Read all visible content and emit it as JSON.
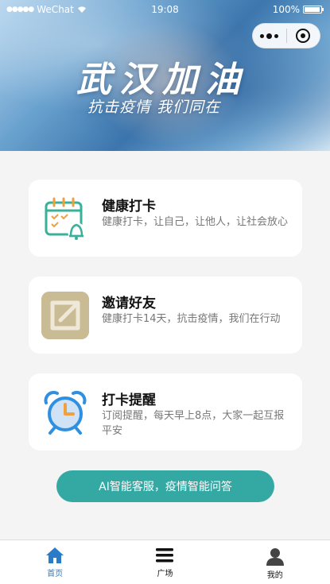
{
  "status_bar": {
    "signal": "●●●●●",
    "carrier": "WeChat",
    "time": "19:08",
    "battery": "100%"
  },
  "hero": {
    "title": "武汉加油",
    "subtitle": "抗击疫情 我们同在"
  },
  "cards": [
    {
      "title": "健康打卡",
      "desc": "健康打卡，让自己，让他人，让社会放心",
      "icon": "calendar-bell-icon"
    },
    {
      "title": "邀请好友",
      "desc": "健康打卡14天，抗击疫情，我们在行动",
      "icon": "share-arrow-icon"
    },
    {
      "title": "打卡提醒",
      "desc": "订阅提醒，每天早上8点，大家一起互报平安",
      "icon": "alarm-clock-icon"
    }
  ],
  "ai_button": {
    "label": "AI智能客服，疫情智能问答"
  },
  "tabbar": {
    "items": [
      {
        "label": "首页",
        "icon": "home-icon",
        "active": true
      },
      {
        "label": "广场",
        "icon": "menu-icon",
        "active": false
      },
      {
        "label": "我的",
        "icon": "user-icon",
        "active": false
      }
    ]
  },
  "colors": {
    "accent": "#34a9a4",
    "tab_active": "#2a7cc9",
    "background": "#f4f4f4"
  }
}
